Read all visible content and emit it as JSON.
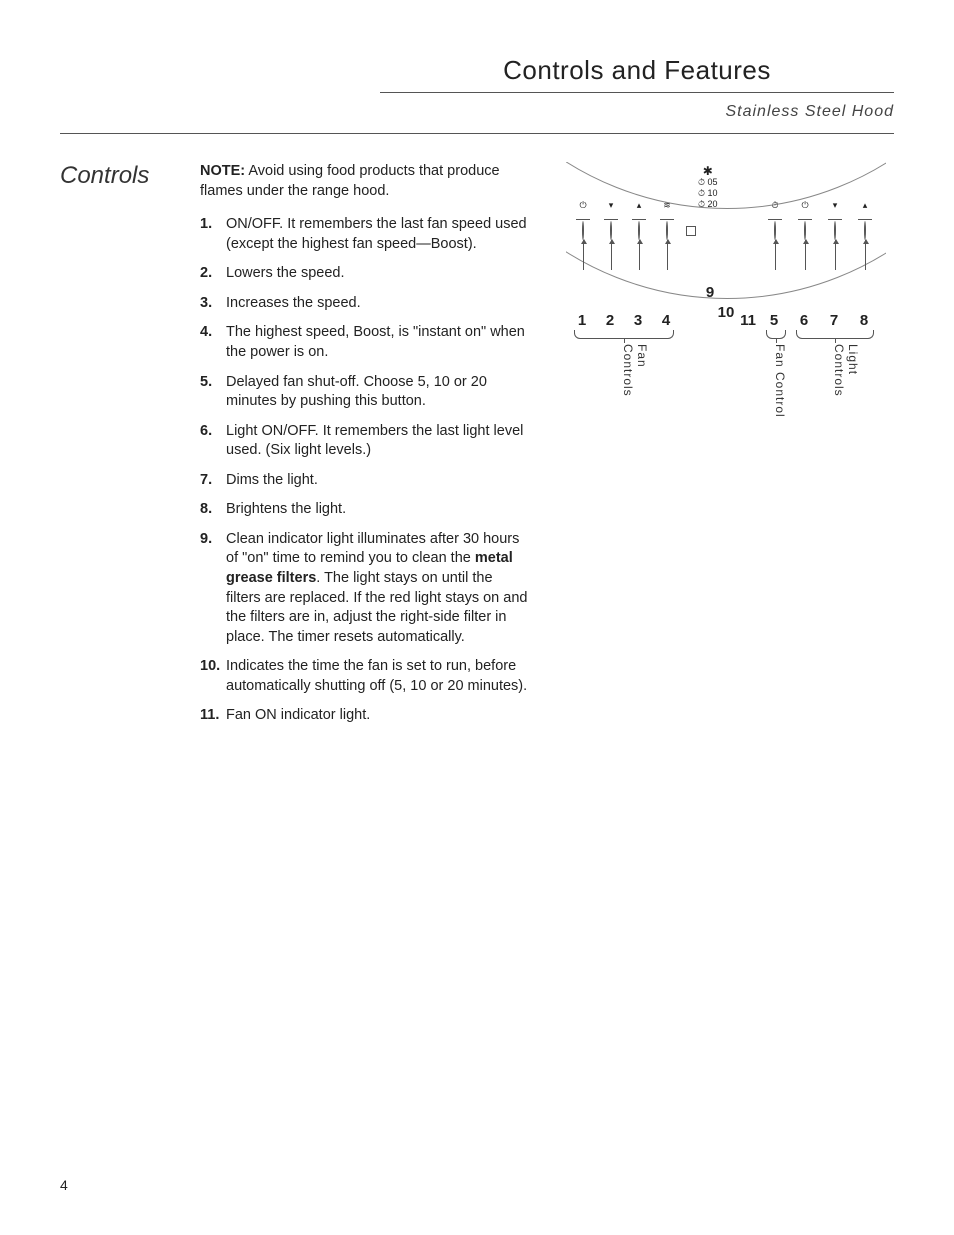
{
  "header": {
    "title": "Controls and Features",
    "subtitle": "Stainless Steel Hood"
  },
  "side_heading": "Controls",
  "note": {
    "label": "NOTE:",
    "text": "Avoid using food products that produce flames under the range hood."
  },
  "items": [
    {
      "n": "1.",
      "t": "ON/OFF. It remembers the last fan speed used (except the highest fan speed—Boost)."
    },
    {
      "n": "2.",
      "t": "Lowers the speed."
    },
    {
      "n": "3.",
      "t": "Increases the speed."
    },
    {
      "n": "4.",
      "t": "The highest speed, Boost, is \"instant on\" when the power is on."
    },
    {
      "n": "5.",
      "t": "Delayed fan shut-off. Choose 5, 10 or 20 minutes by pushing this button."
    },
    {
      "n": "6.",
      "t": "Light ON/OFF. It remembers the last light level used. (Six light levels.)"
    },
    {
      "n": "7.",
      "t": "Dims the light."
    },
    {
      "n": "8.",
      "t": "Brightens the light."
    },
    {
      "n": "9.",
      "pre": "Clean indicator light illuminates after 30 hours of \"on\" time to remind you to clean the ",
      "bold": "metal grease filters",
      "post": ". The light stays on until the filters are replaced. If the red light stays on and the filters are in, adjust the right-side filter in place. The timer resets automatically."
    },
    {
      "n": "10.",
      "t": "Indicates the time the fan is set to run, before automatically shutting off (5, 10 or 20 minutes)."
    },
    {
      "n": "11.",
      "t": "Fan ON indicator light."
    }
  ],
  "diagram": {
    "timer_rows": [
      "✱",
      " ⏱ 05",
      " ⏱ 10",
      " ⏱ 20"
    ],
    "numbers": {
      "n1": "1",
      "n2": "2",
      "n3": "3",
      "n4": "4",
      "n5": "5",
      "n6": "6",
      "n7": "7",
      "n8": "8",
      "n9": "9",
      "n10": "10",
      "n11": "11"
    },
    "group_a": "Fan Controls",
    "group_b": "Fan Control",
    "group_c": "Light Controls",
    "btn_icons": {
      "b1": "⏻",
      "b2": "▾",
      "b3": "▴",
      "b4": "≋",
      "b5": "⏱",
      "b6": "⏻",
      "b7": "▾",
      "b8": "▴"
    }
  },
  "page_number": "4"
}
